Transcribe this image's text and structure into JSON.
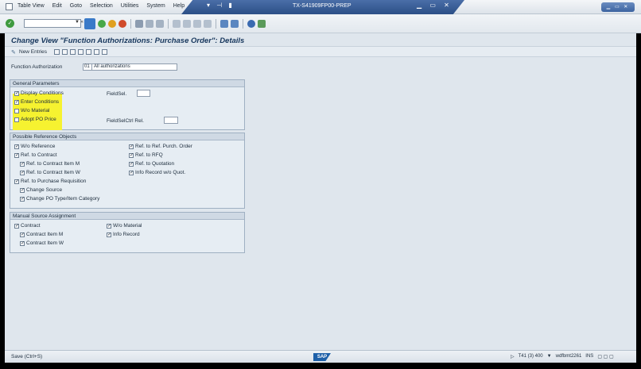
{
  "menubar": {
    "items": [
      "Table View",
      "Edit",
      "Goto",
      "Selection",
      "Utilities",
      "System",
      "Help"
    ],
    "system_title": "TX-S41909FP00-PREP"
  },
  "page": {
    "title": "Change View \"Function Authorizations: Purchase Order\": Details"
  },
  "app_toolbar": {
    "new_entries": "New Entries"
  },
  "function_authorization": {
    "label": "Function Authorization",
    "code": "01",
    "text": "All authorizations"
  },
  "general_parameters": {
    "title": "General Parameters",
    "checkboxes": [
      {
        "label": "Display Conditions",
        "checked": true
      },
      {
        "label": "Enter Conditions",
        "checked": true
      },
      {
        "label": "W/o Material",
        "checked": false
      },
      {
        "label": "Adopt PO Price",
        "checked": false
      }
    ],
    "fieldsel_label": "FieldSel.",
    "fieldselctrl_label": "FieldSelCtrl Rel."
  },
  "possible_reference_objects": {
    "title": "Possible Reference Objects",
    "left": [
      {
        "label": "W/o Reference",
        "checked": true,
        "indent": false
      },
      {
        "label": "Ref. to Contract",
        "checked": true,
        "indent": false
      },
      {
        "label": "Ref. to Contract Item M",
        "checked": true,
        "indent": true
      },
      {
        "label": "Ref. to Contract Item W",
        "checked": true,
        "indent": true
      },
      {
        "label": "Ref. to Purchase Requisition",
        "checked": true,
        "indent": false
      },
      {
        "label": "Change Source",
        "checked": true,
        "indent": true
      },
      {
        "label": "Change PO Type/Item Category",
        "checked": true,
        "indent": true
      }
    ],
    "right": [
      {
        "label": "Ref. to Ref. Purch. Order",
        "checked": true
      },
      {
        "label": "Ref. to RFQ",
        "checked": true
      },
      {
        "label": "Ref. to Quotation",
        "checked": true
      },
      {
        "label": "Info Record w/o Quot.",
        "checked": true
      }
    ]
  },
  "manual_source_assignment": {
    "title": "Manual Source Assignment",
    "left": [
      {
        "label": "Contract",
        "checked": true,
        "indent": false
      },
      {
        "label": "Contract Item M",
        "checked": true,
        "indent": true
      },
      {
        "label": "Contract Item W",
        "checked": true,
        "indent": true
      }
    ],
    "right": [
      {
        "label": "W/o Material",
        "checked": true
      },
      {
        "label": "Info Record",
        "checked": true
      }
    ]
  },
  "statusbar": {
    "message": "Save (Ctrl+S)",
    "session": "T41 (3) 400",
    "server": "wdfbmt2261",
    "mode": "INS"
  },
  "logo_text": "SAP",
  "colors": {
    "highlight": "#f6f230",
    "title_band": "#2b4f86",
    "background": "#dfe6ed"
  }
}
